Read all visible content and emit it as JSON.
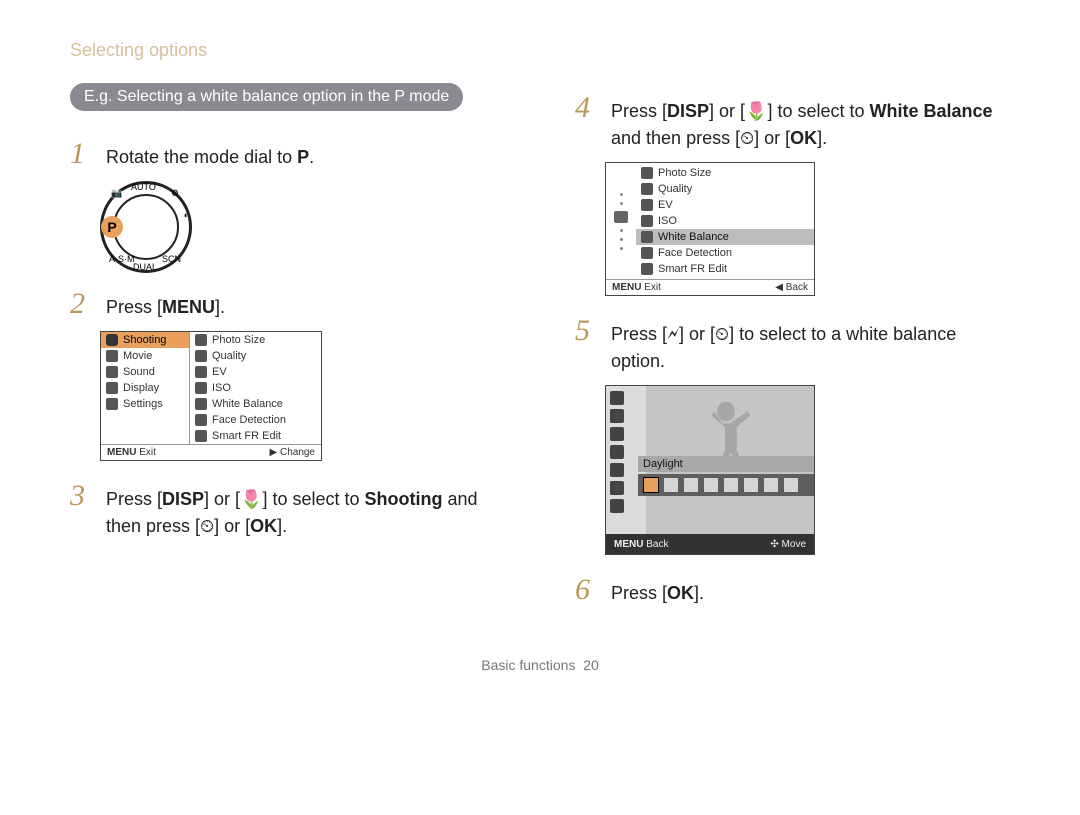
{
  "header": {
    "breadcrumb": "Selecting options"
  },
  "tag": {
    "text": "E.g. Selecting a white balance option in the P mode"
  },
  "steps": {
    "s1_text": "Rotate the mode dial to ",
    "s1_mode": "P",
    "s2_text": "Press [",
    "s2_key": "MENU",
    "s2_after": "].",
    "s3_a": "Press [",
    "s3_key1": "DISP",
    "s3_b": "] or [",
    "s3_key2": "🌷",
    "s3_c": "] to select to ",
    "s3_bold": "Shooting",
    "s3_d": " and then press [",
    "s3_key3": "⏲",
    "s3_e": "] or [",
    "s3_key4": "OK",
    "s3_f": "].",
    "s4_a": "Press [",
    "s4_key1": "DISP",
    "s4_b": "] or [",
    "s4_key2": "🌷",
    "s4_c": "] to select to ",
    "s4_bold": "White Balance",
    "s4_d": " and then press [",
    "s4_key3": "⏲",
    "s4_e": "] or [",
    "s4_key4": "OK",
    "s4_f": "].",
    "s5_a": "Press [",
    "s5_key1": "🗲",
    "s5_b": "] or [",
    "s5_key2": "⏲",
    "s5_c": "] to select to a white balance option.",
    "s6_a": "Press [",
    "s6_key": "OK",
    "s6_b": "]."
  },
  "menu1": {
    "left": [
      "Shooting",
      "Movie",
      "Sound",
      "Display",
      "Settings"
    ],
    "right": [
      "Photo Size",
      "Quality",
      "EV",
      "ISO",
      "White Balance",
      "Face Detection",
      "Smart FR Edit"
    ],
    "foot_left": "Exit",
    "foot_left_key": "MENU",
    "foot_right_sym": "▶",
    "foot_right": "Change"
  },
  "menu2": {
    "items": [
      "Photo Size",
      "Quality",
      "EV",
      "ISO",
      "White Balance",
      "Face Detection",
      "Smart FR Edit"
    ],
    "sel_index": 4,
    "foot_left_key": "MENU",
    "foot_left": "Exit",
    "foot_right_sym": "◀",
    "foot_right": "Back"
  },
  "wb": {
    "label": "Daylight",
    "foot_left_key": "MENU",
    "foot_left": "Back",
    "foot_right_sym": "✣",
    "foot_right": "Move"
  },
  "footer": {
    "section": "Basic functions",
    "page": "20"
  }
}
